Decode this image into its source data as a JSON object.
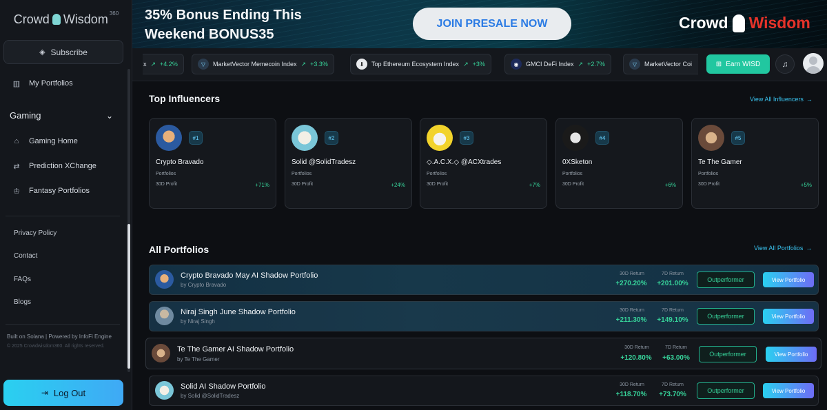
{
  "sidebar": {
    "brand": {
      "part1": "Crowd",
      "part2": "Wisdom",
      "sup": "360"
    },
    "subscribe_label": "Subscribe",
    "my_portfolios": "My Portfolios",
    "section_title": "Gaming",
    "items": [
      {
        "label": "Gaming Home"
      },
      {
        "label": "Prediction XChange"
      },
      {
        "label": "Fantasy Portfolios"
      }
    ],
    "footer_links": [
      "Privacy Policy",
      "Contact",
      "FAQs",
      "Blogs"
    ],
    "built_on": "Built on Solana | Powered by InfoFi Engine",
    "copyright": "© 2025 Crowdwisdom360. All rights reserved.",
    "logout_label": "Log Out"
  },
  "banner": {
    "line1": "35% Bonus Ending This",
    "line2": "Weekend BONUS35",
    "cta": "JOIN PRESALE NOW",
    "logo_part1": "Crowd",
    "logo_part2": "Wisdom"
  },
  "ticker": [
    {
      "name": "x",
      "change": "+4.2%"
    },
    {
      "name": "MarketVector Memecoin Index",
      "change": "+3.3%"
    },
    {
      "name": "Top Ethereum Ecosystem Index",
      "change": "+3%"
    },
    {
      "name": "GMCI DeFi Index",
      "change": "+2.7%"
    },
    {
      "name": "MarketVector Coi",
      "change": ""
    }
  ],
  "header": {
    "earn_label": "Earn WISD"
  },
  "influencers": {
    "title": "Top Influencers",
    "view_all": "View All Influencers",
    "cards": [
      {
        "rank": "#1",
        "name": "Crypto Bravado",
        "sub": "Portfolios",
        "profit_label": "30D Profit",
        "profit": "+71%"
      },
      {
        "rank": "#2",
        "name": "Solid @SolidTradesz",
        "sub": "Portfolios",
        "profit_label": "30D Profit",
        "profit": "+24%"
      },
      {
        "rank": "#3",
        "name": "◇.A.C.X.◇ @ACXtrades",
        "sub": "Portfolios",
        "profit_label": "30D Profit",
        "profit": "+7%"
      },
      {
        "rank": "#4",
        "name": "0XSketon",
        "sub": "Portfolios",
        "profit_label": "30D Profit",
        "profit": "+6%"
      },
      {
        "rank": "#5",
        "name": "Te The Gamer",
        "sub": "Portfolios",
        "profit_label": "30D Profit",
        "profit": "+5%"
      }
    ]
  },
  "portfolios": {
    "title": "All Portfolios",
    "view_all": "View All Portfolios",
    "label_30d": "30D Return",
    "label_7d": "7D Return",
    "badge": "Outperformer",
    "view_label": "View Portfolio",
    "rows": [
      {
        "title": "Crypto Bravado May AI Shadow Portfolio",
        "by": "by Crypto Bravado",
        "r30": "+270.20%",
        "r7": "+201.00%"
      },
      {
        "title": "Niraj Singh June Shadow Portfolio",
        "by": "by Niraj Singh",
        "r30": "+211.30%",
        "r7": "+149.10%"
      },
      {
        "title": "Te The Gamer AI Shadow Portfolio",
        "by": "by Te The Gamer",
        "r30": "+120.80%",
        "r7": "+63.00%"
      },
      {
        "title": "Solid AI Shadow Portfolio",
        "by": "by Solid @SolidTradesz",
        "r30": "+118.70%",
        "r7": "+73.70%"
      }
    ]
  },
  "colors": {
    "accent": "#39c3ef",
    "positive": "#37d39a",
    "earn": "#21c7a0"
  }
}
